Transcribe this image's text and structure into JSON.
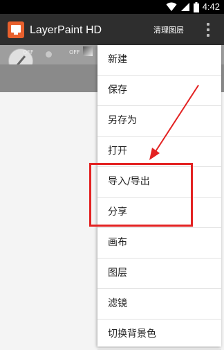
{
  "status_bar": {
    "time": "4:42",
    "icons": [
      "wifi-icon",
      "signal-icon",
      "battery-icon"
    ]
  },
  "app_bar": {
    "title": "LayerPaint HD",
    "clear_layers": "清理图层",
    "overflow_icon": "more-vert-icon"
  },
  "toolbar": {
    "off_left": "OFF",
    "off_right": "OFF"
  },
  "menu": {
    "items": [
      "新建",
      "保存",
      "另存为",
      "打开",
      "导入/导出",
      "分享",
      "画布",
      "图层",
      "滤镜",
      "切换背景色"
    ]
  },
  "colors": {
    "annotation": "#e32222",
    "app_bar": "#2e2e2e",
    "app_icon": "#e8602d"
  }
}
